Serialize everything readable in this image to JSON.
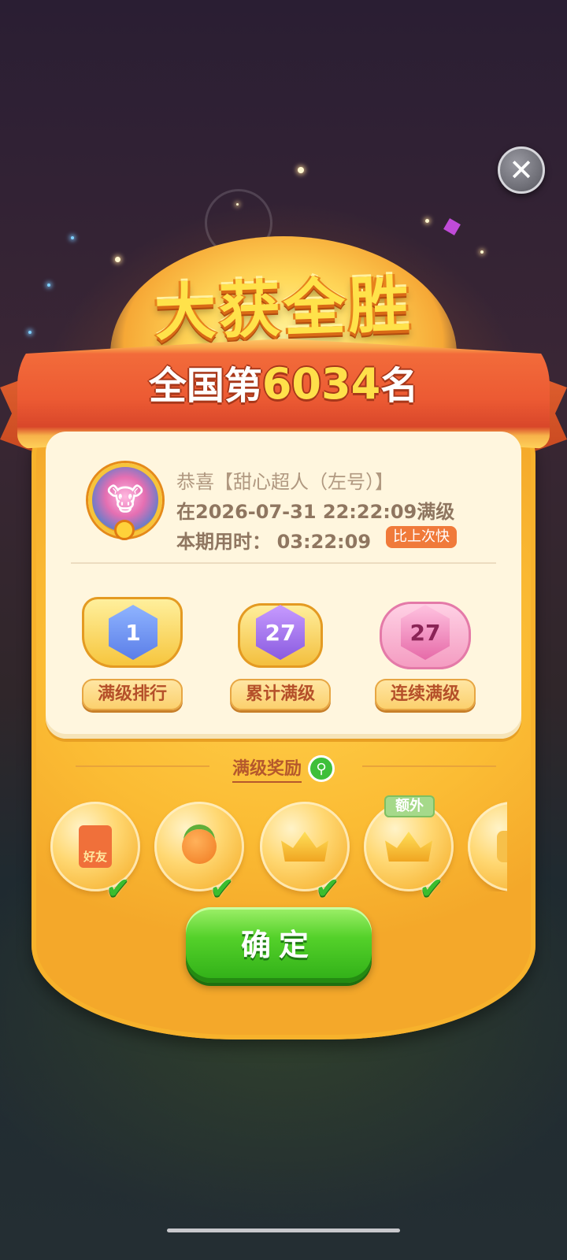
{
  "title": "大获全胜",
  "ranking": {
    "prefix": "全国第",
    "rank": "6034",
    "suffix": "名"
  },
  "congrats": {
    "line1": "恭喜【甜心超人（左号）】",
    "line2": "在2026-07-31 22:22:09满级",
    "time_label": "本期用时：",
    "time_value": "03:22:09",
    "badge": "比上次快"
  },
  "badges": [
    {
      "value": "1",
      "label": "满级排行"
    },
    {
      "value": "27",
      "label": "累计满级"
    },
    {
      "value": "27",
      "label": "连续满级"
    }
  ],
  "rewards": {
    "title": "满级奖励",
    "items": [
      {
        "icon": "red-packet-icon",
        "text": "好友",
        "claimed": true
      },
      {
        "icon": "persimmon-icon",
        "claimed": true
      },
      {
        "icon": "crown-icon",
        "claimed": true
      },
      {
        "icon": "crown-icon",
        "tag": "额外",
        "claimed": true
      },
      {
        "icon": "wing-badge-icon",
        "claimed": false
      }
    ]
  },
  "confirm_label": "确定",
  "colors": {
    "accent_green": "#3bbd2e",
    "ribbon_red": "#ec5a33",
    "panel_yellow": "#fbbc34"
  }
}
